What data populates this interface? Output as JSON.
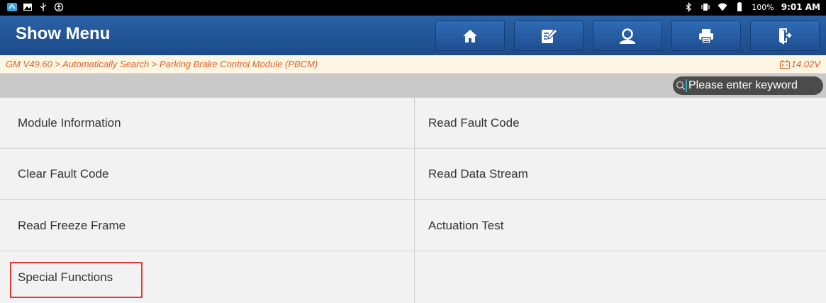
{
  "status_bar": {
    "battery": "100%",
    "time": "9:01 AM"
  },
  "header": {
    "title": "Show Menu",
    "toolbar": [
      {
        "name": "home-icon"
      },
      {
        "name": "edit-report-icon"
      },
      {
        "name": "support-person-icon"
      },
      {
        "name": "print-icon"
      },
      {
        "name": "exit-icon"
      }
    ]
  },
  "breadcrumb": {
    "path": "GM V49.60 > Automatically Search > Parking Brake Control Module (PBCM)",
    "voltage": "14.02V"
  },
  "search": {
    "placeholder": "Please enter keyword"
  },
  "menu": {
    "items": [
      "Module Information",
      "Read Fault Code",
      "Clear Fault Code",
      "Read Data Stream",
      "Read Freeze Frame",
      "Actuation Test",
      "Special Functions"
    ]
  },
  "colors": {
    "appbar": "#1f4e91",
    "breadcrumb_text": "#e0612b",
    "highlight": "#e03a3a"
  }
}
